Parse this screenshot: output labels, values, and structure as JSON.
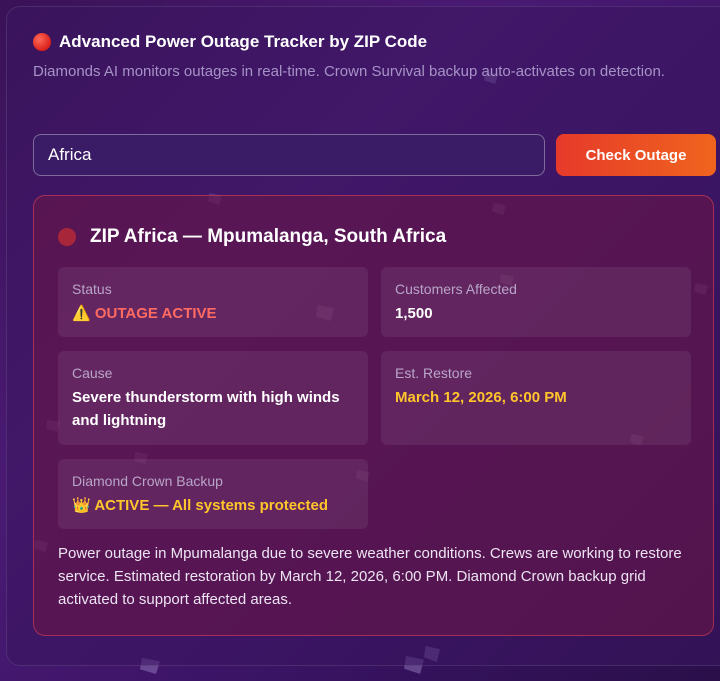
{
  "header": {
    "title": "Advanced Power Outage Tracker by ZIP Code",
    "subtitle": "Diamonds AI monitors outages in real-time. Crown Survival backup auto-activates on detection."
  },
  "search": {
    "value": "Africa",
    "button_label": "Check Outage"
  },
  "result": {
    "title": "ZIP Africa — Mpumalanga, South Africa",
    "status": {
      "label": "Status",
      "icon": "⚠️",
      "value": "OUTAGE ACTIVE"
    },
    "customers": {
      "label": "Customers Affected",
      "value": "1,500"
    },
    "cause": {
      "label": "Cause",
      "value": "Severe thunderstorm with high winds and lightning"
    },
    "restore": {
      "label": "Est. Restore",
      "value": "March 12, 2026, 6:00 PM"
    },
    "backup": {
      "label": "Diamond Crown Backup",
      "icon": "👑",
      "value": "ACTIVE — All systems protected"
    },
    "description": "Power outage in Mpumalanga due to severe weather conditions. Crews are working to restore service. Estimated restoration by March 12, 2026, 6:00 PM. Diamond Crown backup grid activated to support affected areas."
  },
  "colors": {
    "accent": "#e63a2a",
    "status_red": "#ff6b62",
    "gold": "#ffc52a"
  }
}
